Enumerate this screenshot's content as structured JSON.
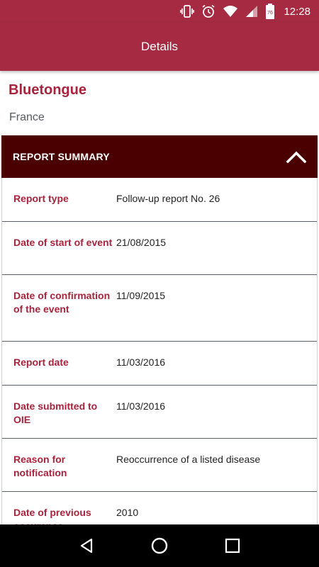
{
  "status_bar": {
    "time": "12:28",
    "battery_level": "76",
    "icons": [
      "vibrate-icon",
      "alarm-icon",
      "wifi-icon",
      "signal-icon",
      "battery-icon"
    ]
  },
  "app_bar": {
    "title": "Details"
  },
  "disease": {
    "name": "Bluetongue",
    "country": "France"
  },
  "section": {
    "title": "REPORT SUMMARY",
    "expanded": true
  },
  "rows": [
    {
      "label": "Report type",
      "value": "Follow-up report No. 26"
    },
    {
      "label": "Date of start of event",
      "value": "21/08/2015"
    },
    {
      "label": "Date of confirmation of the event",
      "value": "11/09/2015"
    },
    {
      "label": "Report date",
      "value": "11/03/2016"
    },
    {
      "label": "Date submitted to OIE",
      "value": "11/03/2016"
    },
    {
      "label": "Reason for notification",
      "value": "Reoccurrence of a listed disease"
    },
    {
      "label": "Date of previous occurence",
      "value": "2010"
    }
  ],
  "colors": {
    "primary": "#a52a42",
    "accent_text": "#a8233b",
    "section_header": "#4a0000"
  }
}
